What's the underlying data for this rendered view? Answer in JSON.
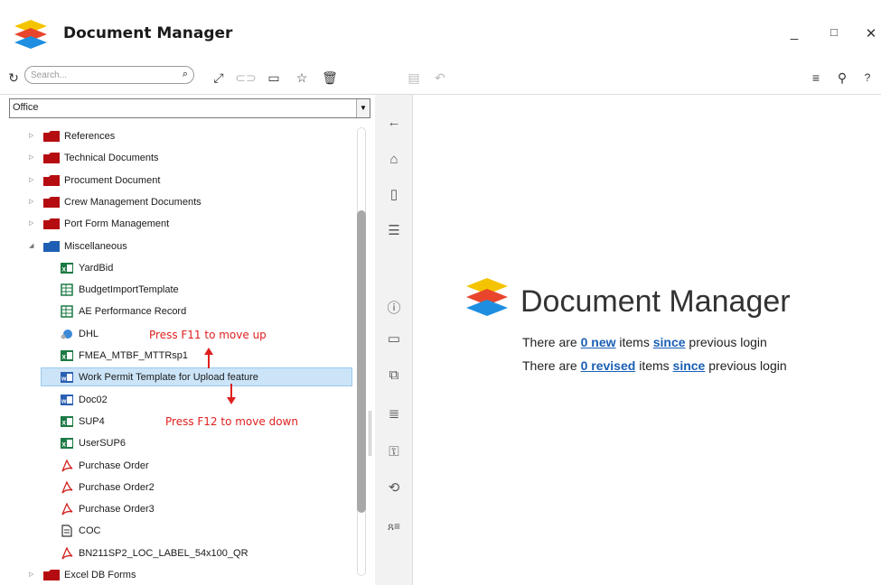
{
  "window": {
    "title": "Document Manager",
    "minimize_label": "_",
    "maximize_label": "□",
    "close_label": "✕"
  },
  "toolbar": {
    "search_placeholder": "Search...",
    "icons": [
      "refresh-icon",
      "search-icon",
      "expand-icon",
      "link-icon",
      "comment-icon",
      "star-icon",
      "trash-icon",
      "save-icon",
      "undo-icon",
      "list-icon",
      "wrench-icon",
      "help-icon"
    ]
  },
  "left": {
    "dropdown_value": "Office",
    "tree": [
      {
        "label": "References",
        "type": "folder"
      },
      {
        "label": "Technical Documents",
        "type": "folder"
      },
      {
        "label": "Procument Document",
        "type": "folder"
      },
      {
        "label": "Crew Management Documents",
        "type": "folder"
      },
      {
        "label": "Port Form Management",
        "type": "folder"
      },
      {
        "label": "Miscellaneous",
        "type": "folder-open"
      },
      {
        "label": "YardBid",
        "type": "excel"
      },
      {
        "label": "BudgetImportTemplate",
        "type": "sheet"
      },
      {
        "label": "AE Performance Record",
        "type": "sheet"
      },
      {
        "label": "DHL",
        "type": "globe"
      },
      {
        "label": "FMEA_MTBF_MTTRsp1",
        "type": "excel"
      },
      {
        "label": "Work Permit Template for Upload feature",
        "type": "word",
        "selected": true
      },
      {
        "label": "Doc02",
        "type": "word"
      },
      {
        "label": "SUP4",
        "type": "excel"
      },
      {
        "label": "UserSUP6",
        "type": "excel"
      },
      {
        "label": "Purchase Order",
        "type": "pdf"
      },
      {
        "label": "Purchase Order2",
        "type": "pdf"
      },
      {
        "label": "Purchase Order3",
        "type": "pdf"
      },
      {
        "label": "COC",
        "type": "doc"
      },
      {
        "label": "BN211SP2_LOC_LABEL_54x100_QR",
        "type": "pdf"
      },
      {
        "label": "Excel DB Forms",
        "type": "folder"
      }
    ]
  },
  "annotations": {
    "up": "Press F11 to move up",
    "down": "Press F12 to move down"
  },
  "main": {
    "brand": "Document Manager",
    "line1": {
      "prefix": "There are ",
      "link": "0 new",
      "mid": " items ",
      "since": "since",
      "suffix": " previous login"
    },
    "line2": {
      "prefix": "There are ",
      "link": "0 revised",
      "mid": " items ",
      "since": "since",
      "suffix": " previous login"
    }
  },
  "colors": {
    "folder": "#b50d12",
    "folder_open": "#1f5fb3",
    "selection": "#cce4f7",
    "annotation": "#e02020",
    "link": "#1a5fb4"
  }
}
